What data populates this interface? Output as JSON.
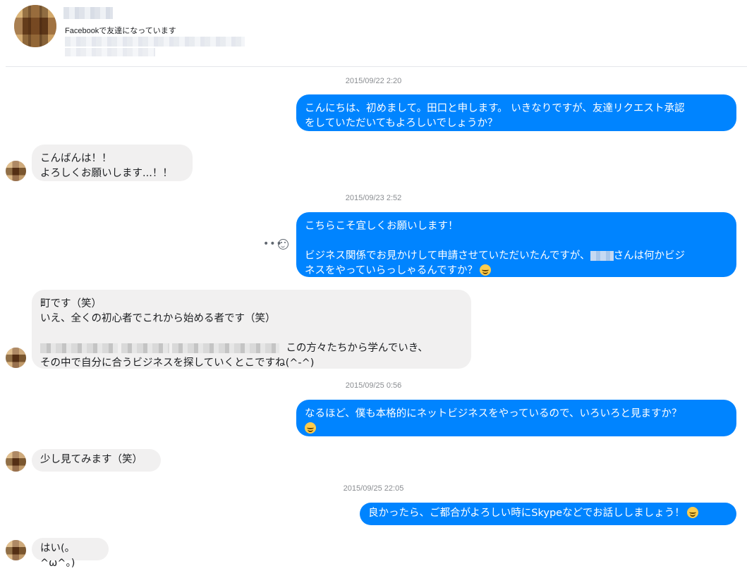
{
  "header": {
    "friend_status": "Facebookで友達になっています"
  },
  "messages": {
    "ts1": "2015/09/22 2:20",
    "m1": "こんにちは、初めまして。田口と申します。 いきなりですが、友達リクエスト承認\nをしていただいてもよろしいでしょうか？",
    "m2": "こんばんは！！\nよろしくお願いします...！！",
    "ts2": "2015/09/23 2:52",
    "m3_a": "こちらこそ宜しくお願いします！\n\nビジネス関係でお見かけして申請させていただいたんですが、",
    "m3_b": "さんは何かビジ\nネスをやっていらっしゃるんですか？",
    "m4_a": "町です（笑）\nいえ、全くの初心者でこれから始める者です（笑）\n\n",
    "m4_b": "この方々たちから学んでいき、\nその中で自分に合うビジネスを探していくとこですね(^-^)",
    "ts3": "2015/09/25 0:56",
    "m5": "なるほど、僕も本格的にネットビジネスをやっているので、いろいろと見ますか？\n",
    "m6": "少し見てみます（笑）",
    "ts4": "2015/09/25 22:05",
    "m7": "良かったら、ご都合がよろしい時にSkypeなどでお話ししましょう！",
    "m8": "はい(。^ω^。)"
  },
  "actions": {
    "more": "•••"
  },
  "icons": [
    "smile-emoji-icon",
    "react-icon",
    "more-actions-icon"
  ]
}
